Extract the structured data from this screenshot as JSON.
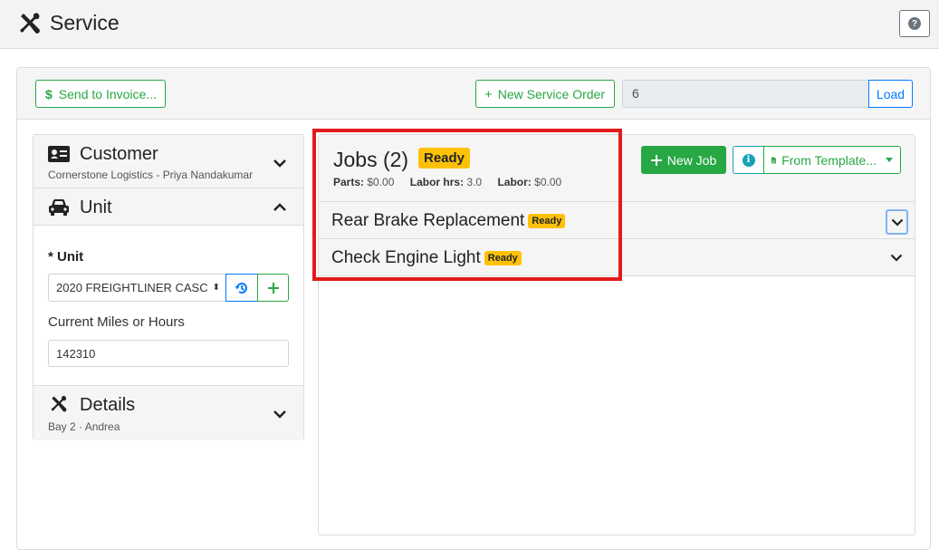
{
  "app": {
    "title": "Service",
    "icon": "wrench-screwdriver-icon",
    "help_icon": "question-circle-icon"
  },
  "toolbar": {
    "send_invoice_label": "Send to Invoice...",
    "send_invoice_icon": "dollar-icon",
    "new_service_order_label": "New Service Order",
    "new_service_order_icon": "plus-icon",
    "order_number_value": "6",
    "load_label": "Load"
  },
  "sidebar": {
    "customer": {
      "title": "Customer",
      "icon": "id-card-icon",
      "subtitle": "Cornerstone Logistics - Priya Nandakumar"
    },
    "unit": {
      "title": "Unit",
      "icon": "car-icon",
      "unit_label": "* Unit",
      "unit_selected": "2020 FREIGHTLINER CASC",
      "miles_label": "Current Miles or Hours",
      "miles_value": "142310"
    },
    "details": {
      "title": "Details",
      "icon": "wrench-screwdriver-icon",
      "subtitle": "Bay 2 · Andrea"
    }
  },
  "jobs": {
    "title": "Jobs (2)",
    "status": "Ready",
    "parts_label": "Parts:",
    "parts_value": "$0.00",
    "labor_hrs_label": "Labor hrs:",
    "labor_hrs_value": "3.0",
    "labor_label": "Labor:",
    "labor_value": "$0.00",
    "new_job_label": "New Job",
    "from_template_label": "From Template...",
    "items": [
      {
        "name": "Rear Brake Replacement",
        "status": "Ready"
      },
      {
        "name": "Check Engine Light",
        "status": "Ready"
      }
    ]
  },
  "colors": {
    "success": "#28a745",
    "primary": "#007bff",
    "info": "#17a2b8",
    "warning": "#ffc107",
    "highlight": "#e31b1b"
  }
}
